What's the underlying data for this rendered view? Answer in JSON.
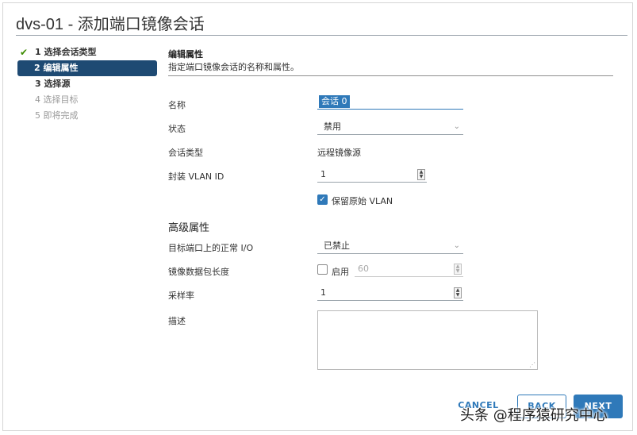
{
  "dialog": {
    "title": "dvs-01 - 添加端口镜像会话"
  },
  "steps": [
    {
      "label": "1 选择会话类型",
      "state": "done"
    },
    {
      "label": "2 编辑属性",
      "state": "active"
    },
    {
      "label": "3 选择源",
      "state": "enabled"
    },
    {
      "label": "4 选择目标",
      "state": "disabled"
    },
    {
      "label": "5 即将完成",
      "state": "disabled"
    }
  ],
  "section": {
    "title": "编辑属性",
    "description": "指定端口镜像会话的名称和属性。"
  },
  "form": {
    "name_label": "名称",
    "name_value": "会话 0",
    "status_label": "状态",
    "status_value": "禁用",
    "session_type_label": "会话类型",
    "session_type_value": "远程镜像源",
    "vlan_label": "封装 VLAN ID",
    "vlan_value": "1",
    "keep_vlan_label": "保留原始 VLAN",
    "keep_vlan_checked": true
  },
  "advanced": {
    "title": "高级属性",
    "normal_io_label": "目标端口上的正常 I/O",
    "normal_io_value": "已禁止",
    "mirror_len_label": "镜像数据包长度",
    "mirror_len_enable_label": "启用",
    "mirror_len_checked": false,
    "mirror_len_value": "60",
    "sampling_label": "采样率",
    "sampling_value": "1",
    "description_label": "描述"
  },
  "buttons": {
    "cancel": "CANCEL",
    "back": "BACK",
    "next": "NEXT"
  },
  "watermark": "头条 @程序猿研究中心",
  "colors": {
    "accent": "#2f79b9",
    "active_step": "#1e4a73",
    "done_check": "#3c8b00"
  }
}
